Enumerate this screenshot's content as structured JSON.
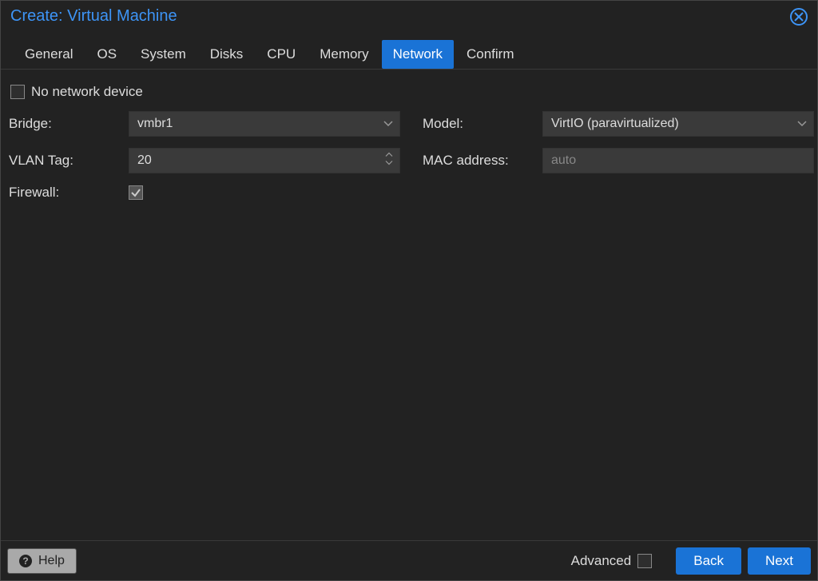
{
  "title": "Create: Virtual Machine",
  "tabs": [
    {
      "label": "General"
    },
    {
      "label": "OS"
    },
    {
      "label": "System"
    },
    {
      "label": "Disks"
    },
    {
      "label": "CPU"
    },
    {
      "label": "Memory"
    },
    {
      "label": "Network",
      "active": true
    },
    {
      "label": "Confirm"
    }
  ],
  "no_network_label": "No network device",
  "fields": {
    "bridge_label": "Bridge:",
    "bridge_value": "vmbr1",
    "vlan_label": "VLAN Tag:",
    "vlan_value": "20",
    "firewall_label": "Firewall:",
    "firewall_checked": true,
    "model_label": "Model:",
    "model_value": "VirtIO (paravirtualized)",
    "mac_label": "MAC address:",
    "mac_placeholder": "auto"
  },
  "footer": {
    "help": "Help",
    "advanced": "Advanced",
    "back": "Back",
    "next": "Next"
  }
}
